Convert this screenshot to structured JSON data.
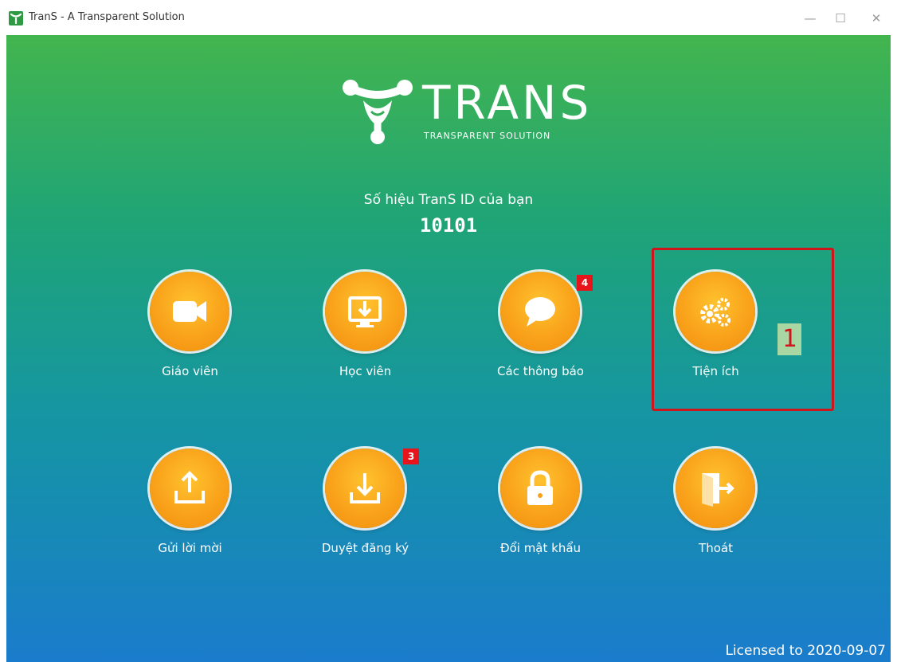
{
  "window": {
    "title": "TranS - A Transparent Solution",
    "minimize": "—",
    "maximize": "☐",
    "close": "✕"
  },
  "logo": {
    "word": "TRANS",
    "subtitle": "TRANSPARENT SOLUTION"
  },
  "id_section": {
    "label": "Số hiệu TranS ID của bạn",
    "value": "10101"
  },
  "tiles": [
    {
      "label": "Giáo viên",
      "icon": "video-camera-icon"
    },
    {
      "label": "Học viên",
      "icon": "monitor-download-icon"
    },
    {
      "label": "Các thông báo",
      "icon": "chat-bubble-icon",
      "badge": "4"
    },
    {
      "label": "Tiện ích",
      "icon": "gears-icon"
    },
    {
      "label": "Gửi lời mời",
      "icon": "upload-icon"
    },
    {
      "label": "Duyệt đăng ký",
      "icon": "download-icon",
      "badge": "3"
    },
    {
      "label": "Đổi mật khẩu",
      "icon": "lock-icon"
    },
    {
      "label": "Thoát",
      "icon": "exit-door-icon"
    }
  ],
  "annotation": {
    "step": "1",
    "color": "#d0141b"
  },
  "footer": {
    "license": "Licensed to 2020-09-07"
  },
  "colors": {
    "gradient_top": "#43b54e",
    "gradient_bottom": "#1a7ccc",
    "button_orange": "#f9a21a",
    "badge_red": "#e8141c"
  }
}
